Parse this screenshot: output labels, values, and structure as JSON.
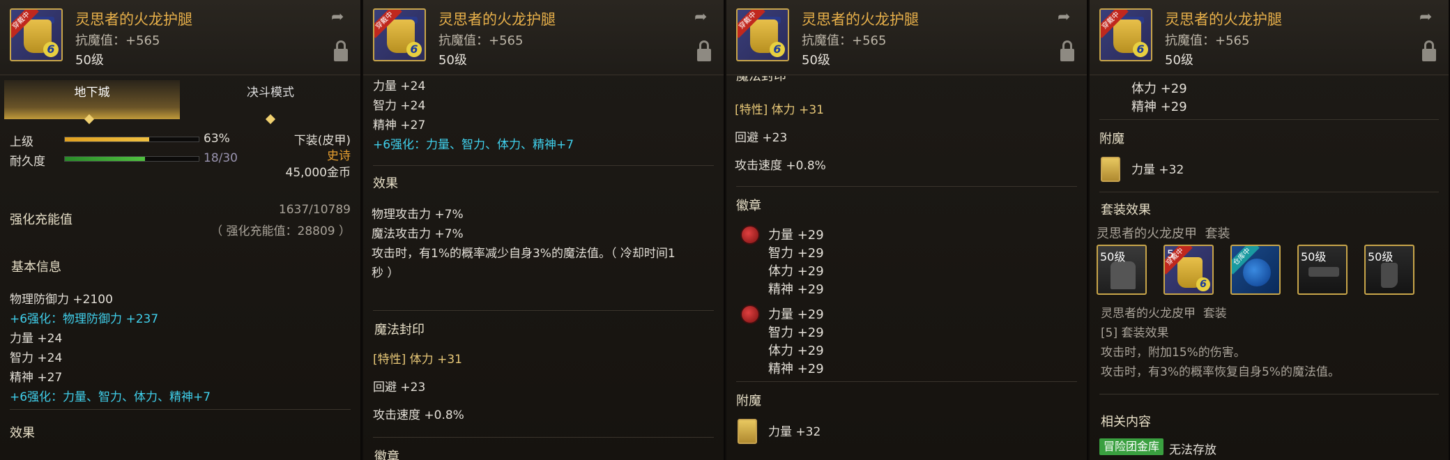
{
  "item": {
    "name": "灵思者的火龙护腿",
    "magic_resist": "抗魔值：+565",
    "level": "50级",
    "badge": "穿戴中"
  },
  "p1": {
    "tabs": [
      "地下城",
      "决斗模式"
    ],
    "grade_label": "上级",
    "grade_pct": "63%",
    "grade_value": 0.63,
    "dur_label": "耐久度",
    "dur_value": "18/30",
    "dur_fill": 0.6,
    "slot": "下装(皮甲)",
    "rarity": "史诗",
    "price": "45,000金币",
    "charge_label": "强化充能值",
    "charge_value": "1637/10789",
    "charge_note": "（ 强化充能值：28809 ）",
    "basic_title": "基本信息",
    "stats": [
      "物理防御力 +2100",
      "+6强化：物理防御力 +237",
      "力量 +24",
      "智力 +24",
      "精神 +27",
      "+6强化：力量、智力、体力、精神+7"
    ],
    "effect_title": "效果"
  },
  "p2": {
    "stats": [
      "力量 +24",
      "智力 +24",
      "精神 +27",
      "+6强化：力量、智力、体力、精神+7"
    ],
    "effect_title": "效果",
    "effects": [
      "物理攻击力 +7%",
      "魔法攻击力 +7%",
      "攻击时，有1%的概率减少自身3%的魔法值。（ 冷却时间1",
      "秒 ）"
    ],
    "seal_title": "魔法封印",
    "seal_lines": [
      "[特性] 体力 +31",
      "回避 +23",
      "攻击速度 +0.8%"
    ],
    "emblem_title_cut": "徽章"
  },
  "p3": {
    "seal_title_cut": "魔法封印",
    "seal_lines": [
      "[特性] 体力 +31",
      "回避 +23",
      "攻击速度 +0.8%"
    ],
    "emblem_title": "徽章",
    "emblem1": [
      "力量 +29",
      "智力 +29",
      "体力 +29",
      "精神 +29"
    ],
    "emblem2": [
      "力量 +29",
      "智力 +29",
      "体力 +29",
      "精神 +29"
    ],
    "enchant_title": "附魔",
    "enchant": "力量 +32"
  },
  "p4": {
    "top_lines": [
      "体力 +29",
      "精神 +29"
    ],
    "enchant_title": "附魔",
    "enchant": "力量 +32",
    "set_title": "套装效果",
    "set_name": "灵思者的火龙皮甲",
    "set_suffix": "套装",
    "slot_levels": [
      "50级",
      "5",
      "",
      "50级",
      "50级"
    ],
    "slot_badges": [
      "",
      "穿戴中",
      "仓库中",
      "",
      ""
    ],
    "set_name2": "灵思者的火龙皮甲",
    "set_suffix2": "套装",
    "set_count": "[5] 套装效果",
    "set_effects": [
      "攻击时，附加15%的伤害。",
      "攻击时，有3%的概率恢复自身5%的魔法值。"
    ],
    "related_title": "相关内容",
    "related_tag": "冒险团金库",
    "related_text": "无法存放"
  },
  "colors": {
    "cyan": "#40d0ec",
    "gold": "#e8b04a",
    "rarity": "#e8a030"
  }
}
